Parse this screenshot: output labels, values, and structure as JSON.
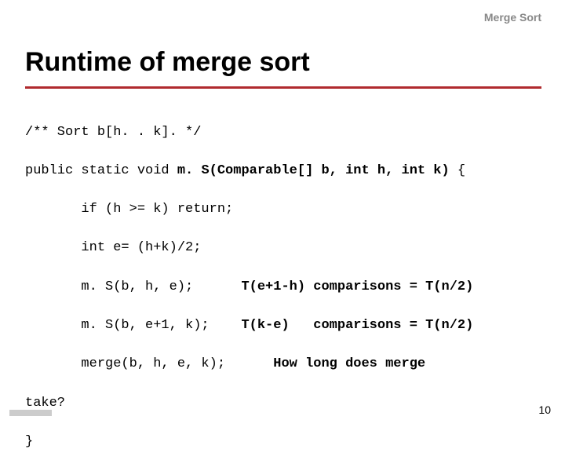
{
  "header": {
    "label": "Merge Sort"
  },
  "title": "Runtime of merge sort",
  "code": {
    "l1": "/** Sort b[h. . k]. */",
    "l2_pre": "public static void ",
    "l2_ms": "m. S(Comparable[] b, int h, int k)",
    "l2_post": " {",
    "l3": "       if (h >= k) return;",
    "l4": "       int e= (h+k)/2;",
    "l5_call": "       m. S(b, h, e);      ",
    "l5_ann": "T(e+1-h) comparisons = T(n/2)",
    "l6_call": "       m. S(b, e+1, k);    ",
    "l6_ann": "T(k-e)   comparisons = T(n/2)",
    "l7_call": "       merge(b, h, e, k);      ",
    "l7_ann": "How long does merge",
    "l8": "take?",
    "l9": "}"
  },
  "pageNumber": "10"
}
